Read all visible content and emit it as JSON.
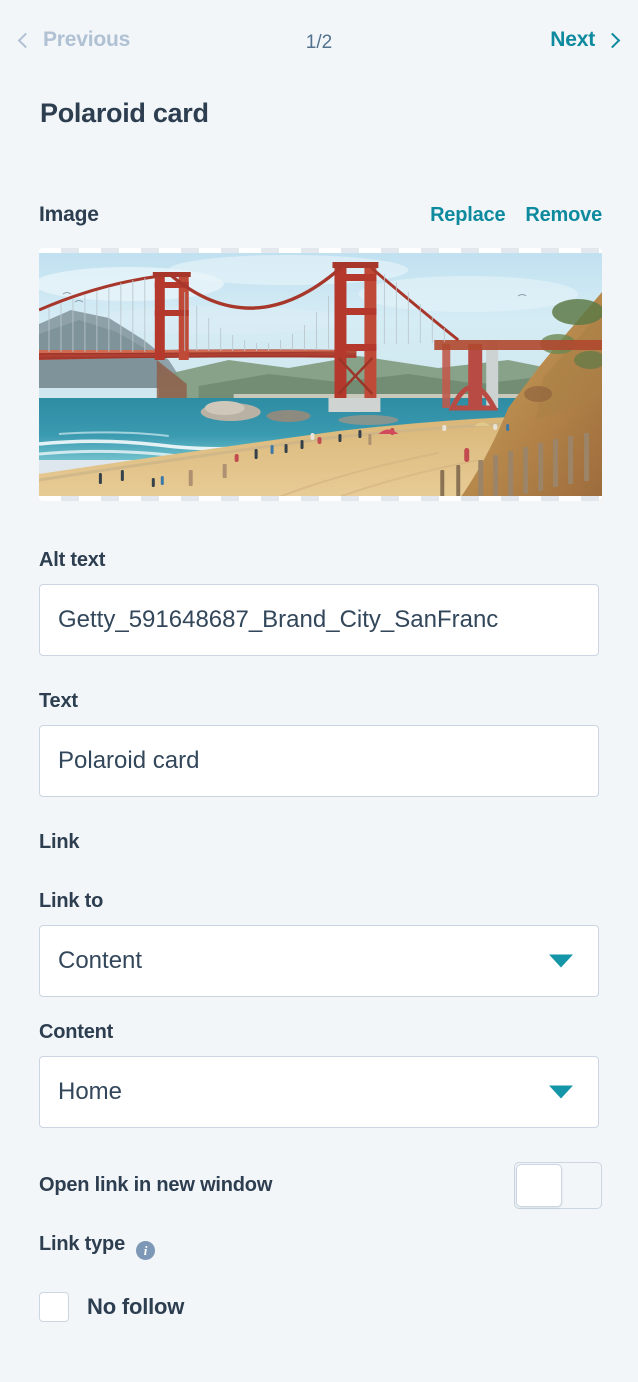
{
  "nav": {
    "previous_label": "Previous",
    "next_label": "Next",
    "counter": "1/2",
    "prev_icon": "chevron-left-icon",
    "next_icon": "chevron-right-icon"
  },
  "page": {
    "title": "Polaroid card"
  },
  "image_section": {
    "label": "Image",
    "replace_label": "Replace",
    "remove_label": "Remove",
    "preview_alt": "Golden Gate Bridge seen from Baker Beach, San Francisco"
  },
  "alt_text": {
    "label": "Alt text",
    "value": "Getty_591648687_Brand_City_SanFranc",
    "placeholder": ""
  },
  "text": {
    "label": "Text",
    "value": "Polaroid card",
    "placeholder": ""
  },
  "link": {
    "heading": "Link",
    "link_to": {
      "label": "Link to",
      "value": "Content",
      "options": [
        "Content"
      ]
    },
    "content": {
      "label": "Content",
      "value": "Home",
      "options": [
        "Home"
      ]
    },
    "open_new_window": {
      "label": "Open link in new window",
      "state": "off"
    },
    "link_type": {
      "label": "Link type",
      "info_icon": "info-icon",
      "checkbox_label": "No follow",
      "checked": false
    }
  },
  "colors": {
    "background": "#f2f6f9",
    "text_primary": "#2d3e50",
    "text_muted": "#51718f",
    "accent_teal": "#0e8a9e",
    "caret_teal": "#1496a8",
    "disabled": "#b0c1d4",
    "border": "#cbd6e2",
    "info": "#7c98b6"
  }
}
